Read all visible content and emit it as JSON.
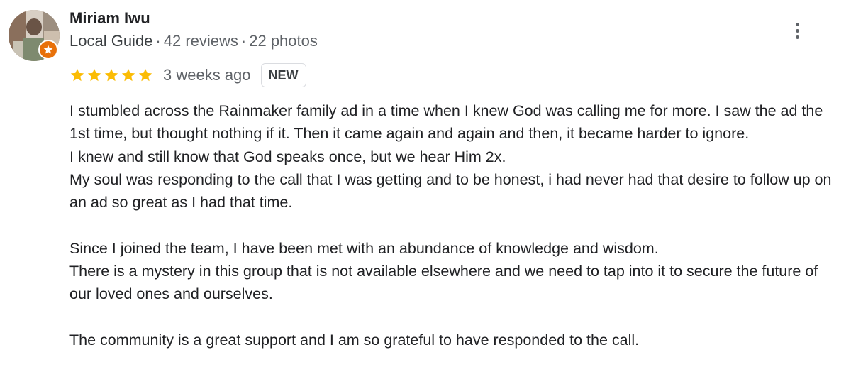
{
  "reviewer": {
    "name": "Miriam Iwu",
    "role": "Local Guide",
    "reviews": "42 reviews",
    "photos": "22 photos",
    "separator": "·"
  },
  "rating": {
    "stars": 5,
    "max_stars": 5,
    "star_color": "#fbbc04",
    "time_ago": "3 weeks ago",
    "badge": "NEW"
  },
  "review_text": "I stumbled across the Rainmaker family ad in a time when I knew God was calling me for more. I saw the ad the 1st time, but thought nothing if it. Then it came again and again and then, it became harder to ignore.\nI knew and still know that God speaks once, but we hear Him 2x.\nMy soul was responding to the call that I was getting and to be honest, i had never had that desire to follow up on an ad so great as I had that time.\n\nSince I joined the team, I have been met with an abundance of knowledge and wisdom.\nThere is a mystery in this group that is not available elsewhere and we need to tap into it to secure the future of our loved ones and ourselves.\n\nThe community is a great support and I am so grateful to have responded to the call.",
  "icons": {
    "avatar": "reviewer-avatar",
    "guide_badge": "local-guide-star-icon",
    "more": "more-vert-icon",
    "star": "star-icon"
  },
  "colors": {
    "guide_badge": "#e8710a",
    "text": "#202124",
    "secondary_text": "#5f6368"
  }
}
